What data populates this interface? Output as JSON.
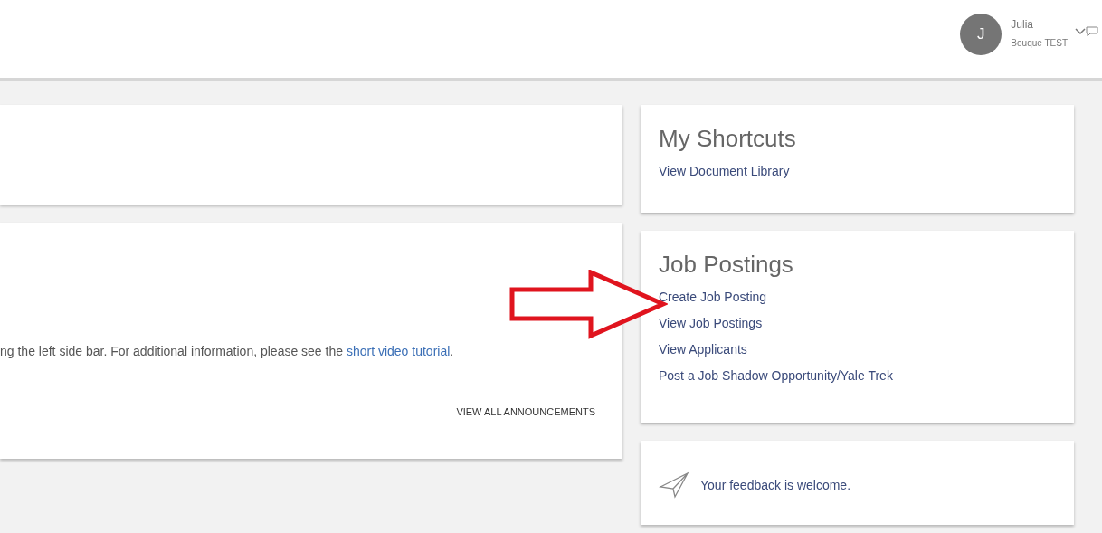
{
  "header": {
    "user": {
      "initial": "J",
      "name": "Julia",
      "org": "Bouque TEST"
    }
  },
  "announcements": {
    "text_before": "ng the left side bar. For additional information, please see the ",
    "link": "short video tutorial",
    "text_after": ".",
    "button": "VIEW ALL ANNOUNCEMENTS"
  },
  "shortcuts": {
    "title": "My Shortcuts",
    "links": [
      "View Document Library"
    ]
  },
  "job_postings": {
    "title": "Job Postings",
    "links": [
      "Create Job Posting",
      "View Job Postings",
      "View Applicants",
      "Post a Job Shadow Opportunity/Yale Trek"
    ]
  },
  "feedback": {
    "text": "Your feedback is welcome."
  }
}
